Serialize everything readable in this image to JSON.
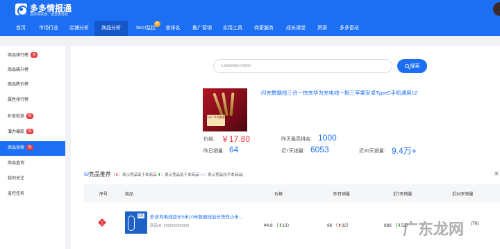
{
  "brand": {
    "name": "多多情报通",
    "tagline": "选择情报通，运营更轻松"
  },
  "nav": [
    {
      "label": "首页"
    },
    {
      "label": "市场行业"
    },
    {
      "label": "店铺分析"
    },
    {
      "label": "商品分析",
      "active": true
    },
    {
      "label": "SKU监控",
      "badge": "新"
    },
    {
      "label": "查排名"
    },
    {
      "label": "推广营销"
    },
    {
      "label": "实用工具"
    },
    {
      "label": "商家服务"
    },
    {
      "label": "成长课堂"
    },
    {
      "label": "资源"
    },
    {
      "label": "多多雷达"
    }
  ],
  "sidebar": [
    {
      "label": "商品排行榜",
      "badge": "热"
    },
    {
      "label": "商品飙升榜"
    },
    {
      "label": "商品降价榜"
    },
    {
      "label": "属性排行榜"
    },
    {
      "label": "补单检测",
      "badge": "热"
    },
    {
      "label": "潜力爆款",
      "badge": "热"
    },
    {
      "label": "商品探索",
      "badge": "热",
      "active": true
    },
    {
      "label": "商品查询"
    },
    {
      "label": "我的关注"
    },
    {
      "label": "监控任务"
    }
  ],
  "search": {
    "value": "1385866070860",
    "button": "搜索"
  },
  "product": {
    "title": "闪充数据线三合一快充华为充电线一拖三苹果安卓TypeC手机通用12",
    "image_text": "2021 牛年聚惠",
    "price_label": "价格:",
    "price_value": "￥17.80",
    "rank_label": "昨天最高排名:",
    "rank_value": "1000",
    "yesterday_label": "昨日销量:",
    "yesterday_value": "64",
    "sales7_label": "近7天销量:",
    "sales7_value": "6053",
    "sales30_label": "近30天销量:",
    "sales30_value": "9.4万+"
  },
  "recommend": {
    "title": "竞品推荐",
    "legend_open": "(",
    "legend_up": "：表示竞品高于本商品",
    "legend_down": "：表示竞品低于本商品",
    "legend_eq": "：表示竞品持平本商品)",
    "cut_text": "关"
  },
  "table": {
    "headers": [
      "序号",
      "商品",
      "价格",
      "昨日销量",
      "近7天销量",
      "近30天销量"
    ],
    "rows": [
      {
        "rank": "1",
        "title": "安卓充电线超长5米10米数据线加长快充小米...",
        "id": "商品ID: 200000000000",
        "img_label": "5米",
        "price": "¥4.8",
        "price_delta": "13",
        "yesterday": "96",
        "yesterday_delta": "32",
        "sales7": "886",
        "sales7_delta": "52",
        "sales30": "(76)"
      }
    ]
  },
  "watermark": "广东龙网",
  "colors": {
    "primary": "#1c6ef2",
    "up": "#e8383d",
    "down": "#2aa84a",
    "badge": "#e8383d"
  }
}
